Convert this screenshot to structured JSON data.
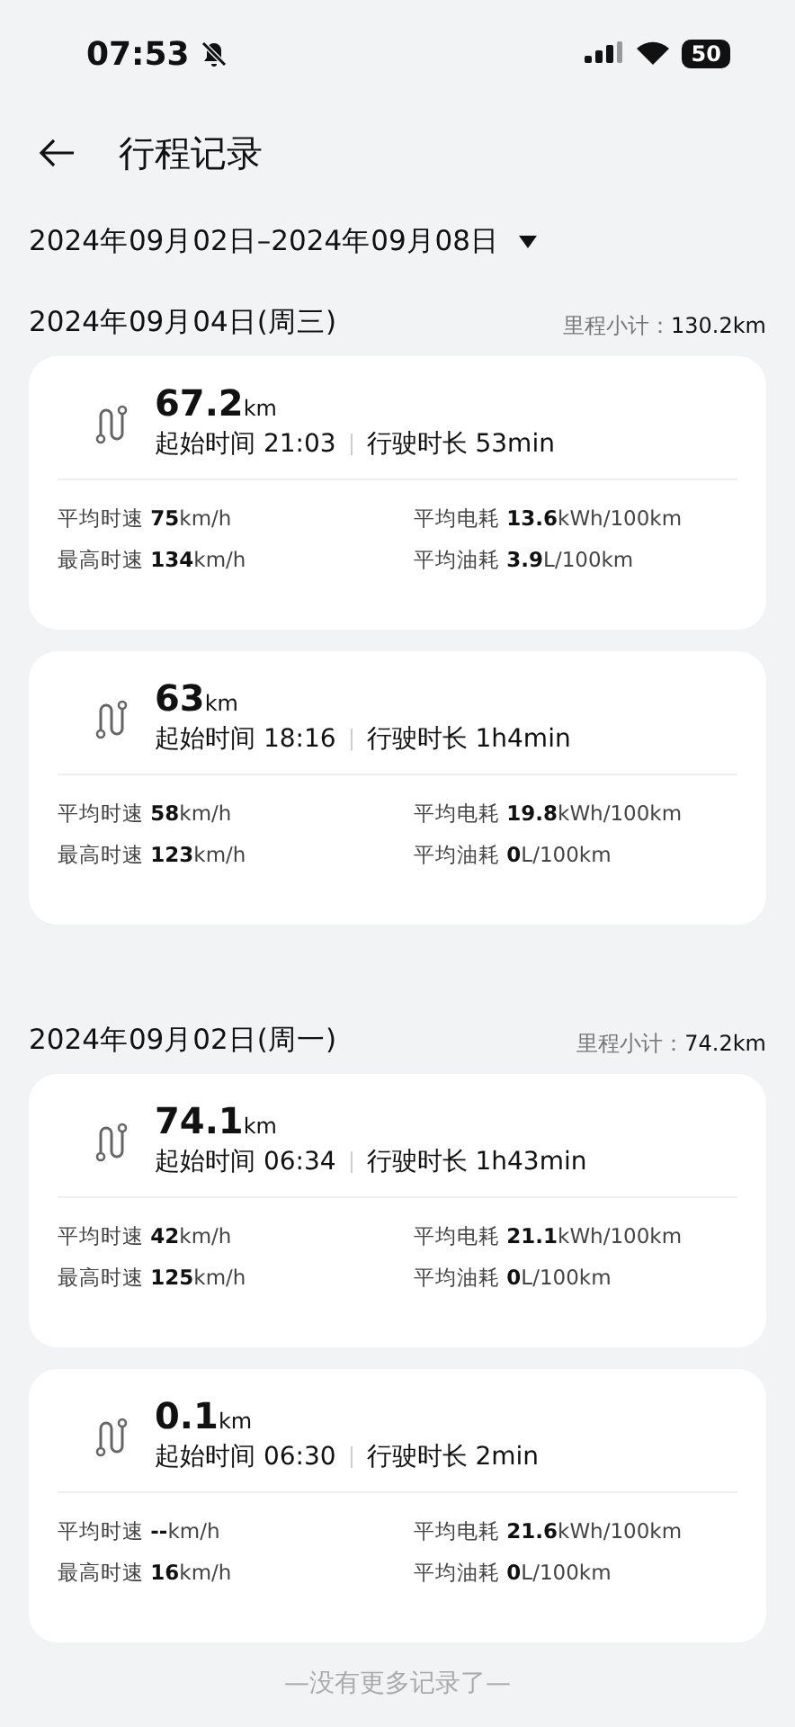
{
  "status_bar": {
    "time": "07:53",
    "muted": true,
    "battery": "50"
  },
  "header": {
    "title": "行程记录"
  },
  "range": {
    "label": "2024年09月02日–2024年09月08日"
  },
  "groups": [
    {
      "date": "2024年09月04日(周三)",
      "subtotal_label": "里程小计：",
      "subtotal": "130.2km",
      "trips": [
        {
          "distance": "67.2",
          "unit": "km",
          "start": "起始时间 21:03",
          "duration": "行驶时长 53min",
          "stats": [
            "平均时速 **75**km/h",
            "平均电耗 **13.6**kWh/100km",
            "最高时速 **134**km/h",
            "平均油耗 **3.9**L/100km"
          ]
        },
        {
          "distance": "63",
          "unit": "km",
          "start": "起始时间 18:16",
          "duration": "行驶时长 1h4min",
          "stats": [
            "平均时速 **58**km/h",
            "平均电耗 **19.8**kWh/100km",
            "最高时速 **123**km/h",
            "平均油耗 **0**L/100km"
          ]
        }
      ]
    },
    {
      "date": "2024年09月02日(周一)",
      "subtotal_label": "里程小计：",
      "subtotal": "74.2km",
      "trips": [
        {
          "distance": "74.1",
          "unit": "km",
          "start": "起始时间 06:34",
          "duration": "行驶时长 1h43min",
          "stats": [
            "平均时速 **42**km/h",
            "平均电耗 **21.1**kWh/100km",
            "最高时速 **125**km/h",
            "平均油耗 **0**L/100km"
          ]
        },
        {
          "distance": "0.1",
          "unit": "km",
          "start": "起始时间 06:30",
          "duration": "行驶时长 2min",
          "stats": [
            "平均时速 **--**km/h",
            "平均电耗 **21.6**kWh/100km",
            "最高时速 **16**km/h",
            "平均油耗 **0**L/100km"
          ]
        }
      ]
    }
  ],
  "footer": "—没有更多记录了—"
}
